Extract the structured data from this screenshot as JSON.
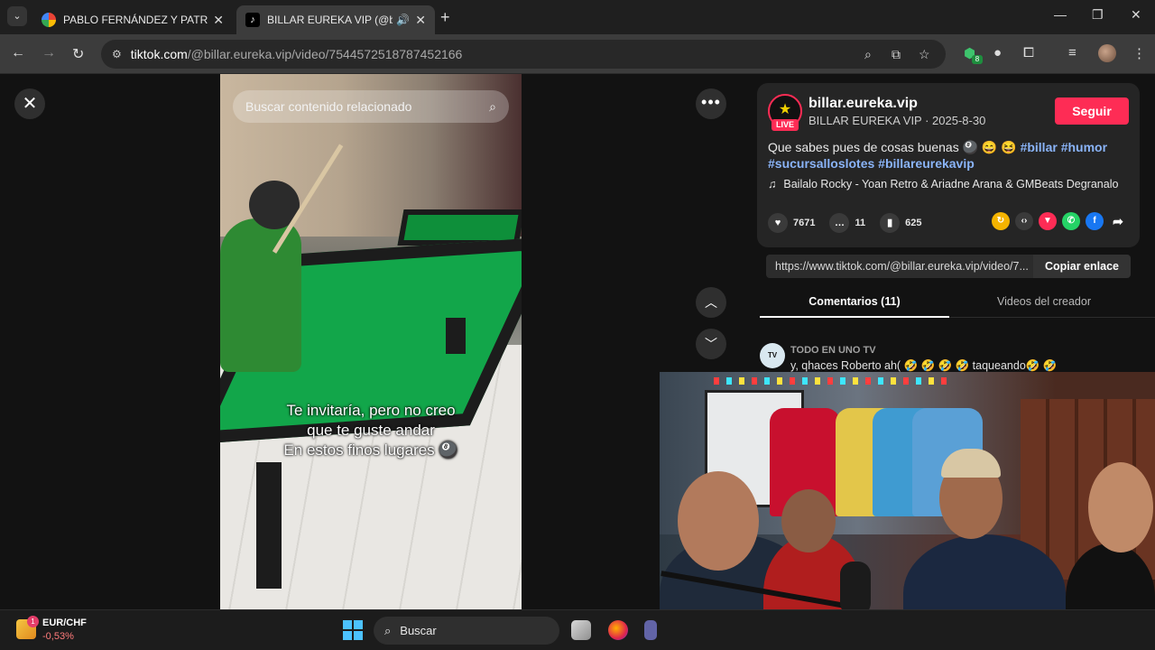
{
  "browser": {
    "tabs": [
      {
        "title": "PABLO FERNÁNDEZ Y PATRICIA",
        "close": "✕"
      },
      {
        "title": "BILLAR EUREKA VIP (@billar",
        "close": "✕",
        "sound": "🔊"
      }
    ],
    "new_tab": "+",
    "window_controls": {
      "minimize": "—",
      "restore": "❐",
      "close": "✕"
    },
    "url_host": "tiktok.com",
    "url_path": "/@billar.eureka.vip/video/7544572518787452166",
    "ext_badge": "8"
  },
  "video": {
    "search_placeholder": "Buscar contenido relacionado",
    "caption_lines": [
      "Te invitaría, pero no creo",
      "que te guste andar",
      "En estos finos lugares 🎱"
    ]
  },
  "controls": {
    "close": "✕",
    "more": "•••",
    "prev": "︿",
    "next": "﹀"
  },
  "post": {
    "username": "billar.eureka.vip",
    "display_name": "BILLAR EUREKA VIP · 2025-8-30",
    "live": "LIVE",
    "follow": "Seguir",
    "description_text": "Que sabes pues de cosas buenas 🎱 😄 😆",
    "hashtags": [
      "#billar",
      "#humor",
      "#sucursalloslotes",
      "#billareurekavip"
    ],
    "music": "Bailalo Rocky - Yoan Retro & Ariadne Arana & GMBeats Degranalo",
    "likes": "7671",
    "comments": "11",
    "saves": "625",
    "link": "https://www.tiktok.com/@billar.eureka.vip/video/7...",
    "copy_link": "Copiar enlace"
  },
  "tabs": {
    "comments": "Comentarios (11)",
    "creator_videos": "Videos del creador"
  },
  "comment": {
    "author": "TODO EN UNO TV",
    "text": "y, qhaces Roberto ah( 🤣 🤣 🤣 🤣  taqueando🤣 🤣"
  },
  "taskbar": {
    "widget_badge": "1",
    "widget_name": "EUR/CHF",
    "widget_value": "-0,53%",
    "search": "Buscar"
  },
  "colors": {
    "accent": "#fe2c55",
    "hashtag": "#8ab4f8"
  }
}
